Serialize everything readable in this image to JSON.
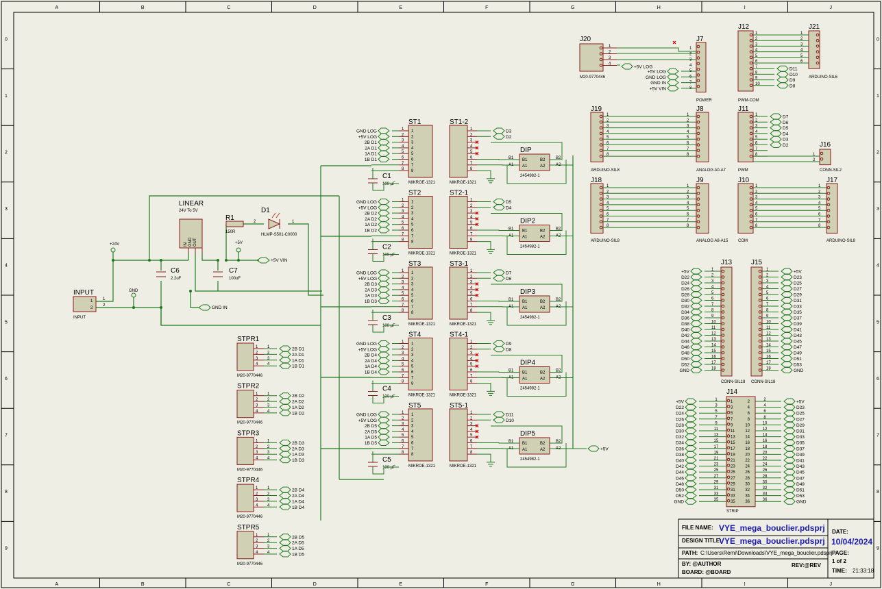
{
  "frame": {
    "columns": [
      "A",
      "B",
      "C",
      "D",
      "E",
      "F",
      "G",
      "H",
      "I",
      "J"
    ],
    "rows": [
      "0",
      "1",
      "2",
      "3",
      "4",
      "5",
      "6",
      "7",
      "8",
      "9"
    ]
  },
  "power": {
    "linear": {
      "ref": "LINEAR",
      "value": "24V To 5V",
      "pins": [
        "IN",
        "GND",
        "OUT"
      ]
    },
    "r1": {
      "ref": "R1",
      "value": "150R"
    },
    "d1": {
      "ref": "D1",
      "value": "HLMP-S501-C0000"
    },
    "c6": {
      "ref": "C6",
      "value": "2.2uF"
    },
    "c7": {
      "ref": "C7",
      "value": "100uF"
    },
    "input": {
      "ref": "INPUT",
      "value": "INPUT"
    },
    "p24": "+24V",
    "p5": "+5V",
    "gnd": "GND",
    "vin": "+5V VIN",
    "gndin": "GND IN"
  },
  "stages": [
    {
      "st": "ST1",
      "stv": "MIKROE-1321",
      "sn": "ST1-2",
      "c": "C1",
      "cv": "100 µF",
      "dip": "DIP",
      "nets": [
        "GND LOG",
        "+5V LOG",
        "2B D1",
        "2A D1",
        "1A D1",
        "1B D1"
      ],
      "out": [
        "D3",
        "D2"
      ]
    },
    {
      "st": "ST2",
      "stv": "MIKROE-1321",
      "sn": "ST2-1",
      "c": "C2",
      "cv": "100 µF",
      "dip": "DIP2",
      "nets": [
        "GND LOG",
        "+5V LOG",
        "2B D2",
        "2A D2",
        "1A D2",
        "1B D2"
      ],
      "out": [
        "D5",
        "D4"
      ]
    },
    {
      "st": "ST3",
      "stv": "MIKROE-1321",
      "sn": "ST3-1",
      "c": "C3",
      "cv": "100 µF",
      "dip": "DIP3",
      "nets": [
        "GND LOG",
        "+5V LOG",
        "2B D3",
        "2A D3",
        "1A D3",
        "1B D3"
      ],
      "out": [
        "D7",
        "D6"
      ]
    },
    {
      "st": "ST4",
      "stv": "MIKROE-1321",
      "sn": "ST4-1",
      "c": "C4",
      "cv": "100 µF",
      "dip": "DIP4",
      "nets": [
        "GND LOG",
        "+5V LOG",
        "2B D4",
        "2A D4",
        "1A D4",
        "1B D4"
      ],
      "out": [
        "D9",
        "D8"
      ]
    },
    {
      "st": "ST5",
      "stv": "MIKROE-1321",
      "sn": "ST5-1",
      "c": "C5",
      "cv": "100 µF",
      "dip": "DIP5",
      "nets": [
        "GND LOG",
        "+5V LOG",
        "2B D5",
        "2A D5",
        "1A D5",
        "1B D5"
      ],
      "out": [
        "D11",
        "D10"
      ]
    }
  ],
  "dip_value": "2454982-1",
  "dip_pins": [
    "B1",
    "A1",
    "B2",
    "A2"
  ],
  "dip_out_net": "+5V",
  "stprs": [
    {
      "ref": "STPR1",
      "value": "M20-9770446",
      "nets": [
        "2B D1",
        "2A D1",
        "1A D1",
        "1B D1"
      ]
    },
    {
      "ref": "STPR2",
      "value": "M20-9770446",
      "nets": [
        "2B D2",
        "2A D2",
        "1A D2",
        "1B D2"
      ]
    },
    {
      "ref": "STPR3",
      "value": "M20-9770446",
      "nets": [
        "2B D3",
        "2A D3",
        "1A D3",
        "1B D3"
      ]
    },
    {
      "ref": "STPR4",
      "value": "M20-9770446",
      "nets": [
        "2B D4",
        "2A D4",
        "1A D4",
        "1B D4"
      ]
    },
    {
      "ref": "STPR5",
      "value": "M20-9770446",
      "nets": [
        "2B D5",
        "2A D5",
        "1A D5",
        "1B D5"
      ]
    }
  ],
  "j20": {
    "ref": "J20",
    "value": "M20-9770446",
    "net": "+5V LOG"
  },
  "j7": {
    "ref": "J7",
    "value": "POWER",
    "nets": [
      "+5V LOG",
      "GND LOG",
      "GND IN",
      "+5V VIN"
    ]
  },
  "j12": {
    "ref": "J12",
    "value": "PWM-COM",
    "nets": [
      "D11",
      "D10",
      "D9",
      "D8"
    ]
  },
  "j21": {
    "ref": "J21",
    "value": "ARDUINO-SIL6"
  },
  "j19": {
    "ref": "J19",
    "value": "ARDUINO-SIL8"
  },
  "j8": {
    "ref": "J8",
    "value": "ANALOG A0-A7"
  },
  "j11": {
    "ref": "J11",
    "value": "PWM",
    "nets": [
      "D7",
      "D6",
      "D5",
      "D4",
      "D3",
      "D2"
    ]
  },
  "j16": {
    "ref": "J16",
    "value": "CONN-SIL2"
  },
  "j18": {
    "ref": "J18",
    "value": "ARDUINO-SIL8"
  },
  "j9": {
    "ref": "J9",
    "value": "ANALOG A8-A15"
  },
  "j10": {
    "ref": "J10",
    "value": "COM"
  },
  "j17": {
    "ref": "J17",
    "value": "ARDUINO-SIL8"
  },
  "j13": {
    "ref": "J13",
    "value": "CONN-SIL18",
    "nets": [
      "+5V",
      "D22",
      "D24",
      "D26",
      "D28",
      "D30",
      "D32",
      "D34",
      "D36",
      "D38",
      "D40",
      "D42",
      "D44",
      "D46",
      "D48",
      "D50",
      "D52",
      "GND"
    ]
  },
  "j15": {
    "ref": "J15",
    "value": "CONN-SIL18",
    "nets": [
      "+5V",
      "D23",
      "D25",
      "D27",
      "D29",
      "D31",
      "D33",
      "D35",
      "D37",
      "D39",
      "D41",
      "D43",
      "D45",
      "D47",
      "D49",
      "D51",
      "D53",
      "GND"
    ]
  },
  "j14": {
    "ref": "J14",
    "value": "STRIP"
  },
  "titleblock": {
    "file_label": "FILE NAME:",
    "file": "VYE_mega_bouclier.pdsprj",
    "design_label": "DESIGN TITLE:",
    "design": "VYE_mega_bouclier.pdsprj",
    "path_label": "PATH:",
    "path": "C:\\Users\\Rémi\\Downloads\\VYE_mega_bouclier.pdsprj",
    "by": "BY:   @AUTHOR",
    "rev": "REV:@REV",
    "board": "BOARD: @BOARD",
    "page": "PAGE:",
    "pageval": "1    of    2",
    "date_label": "DATE:",
    "date": "10/04/2024",
    "time_label": "TIME:",
    "time": "21:33:18"
  },
  "colors": {
    "wire": "#1f7a1f",
    "part": "#8b1a1a",
    "body": "#cfd0b4",
    "sheet": "#eeeee4",
    "title": "#1a1ab0"
  }
}
